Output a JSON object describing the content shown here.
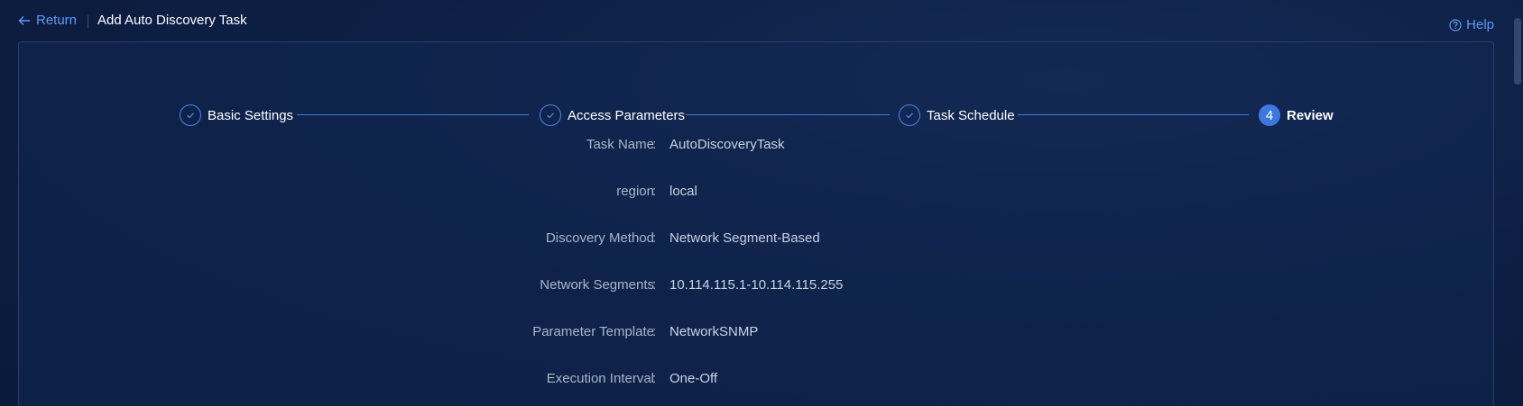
{
  "header": {
    "return_label": "Return",
    "title": "Add Auto Discovery Task",
    "help_label": "Help"
  },
  "steps": [
    {
      "label": "Basic Settings",
      "state": "done",
      "icon": "check-icon"
    },
    {
      "label": "Access Parameters",
      "state": "done",
      "icon": "check-icon"
    },
    {
      "label": "Task Schedule",
      "state": "done",
      "icon": "check-icon"
    },
    {
      "label": "Review",
      "state": "active",
      "number": "4"
    }
  ],
  "review": [
    {
      "label": "Task Name",
      "value": "AutoDiscoveryTask"
    },
    {
      "label": "region",
      "value": "local"
    },
    {
      "label": "Discovery Method",
      "value": "Network Segment-Based"
    },
    {
      "label": "Network Segments",
      "value": "10.114.115.1-10.114.115.255"
    },
    {
      "label": "Parameter Template",
      "value": "NetworkSNMP"
    },
    {
      "label": "Execution Interval",
      "value": "One-Off"
    }
  ],
  "colon": ":",
  "colors": {
    "accent": "#3b78e0",
    "link": "#5b9bf5",
    "background": "#0d1f44"
  }
}
